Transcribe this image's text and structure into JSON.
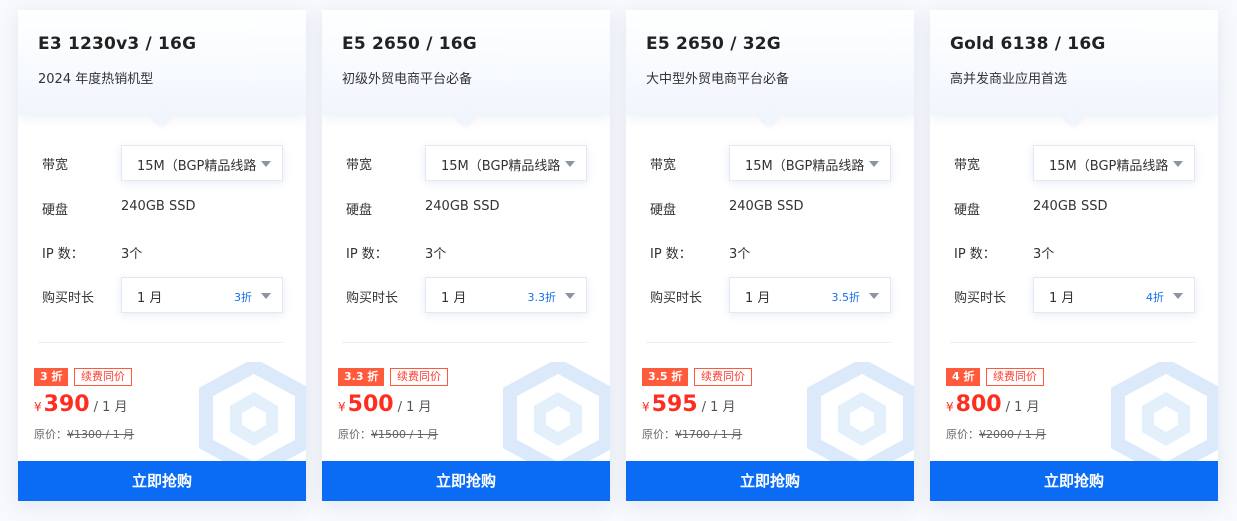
{
  "labels": {
    "bandwidth": "带宽",
    "disk": "硬盘",
    "ip": "IP 数：",
    "duration": "购买时长",
    "renew_tag": "续费同价",
    "orig_prefix": "原价：",
    "per_unit": "/ 1 月",
    "currency": "¥",
    "buy_button": "立即抢购"
  },
  "plans": [
    {
      "title": "E3 1230v3 / 16G",
      "subtitle": "2024 年度热销机型",
      "bandwidth": "15M（BGP精品线路）",
      "disk": "240GB SSD",
      "ip": "3个",
      "duration": "1 月",
      "duration_discount": "3折",
      "discount_tag": "3 折",
      "price": "390",
      "orig_price": "¥1300 / 1 月"
    },
    {
      "title": "E5 2650 / 16G",
      "subtitle": "初级外贸电商平台必备",
      "bandwidth": "15M（BGP精品线路）",
      "disk": "240GB SSD",
      "ip": "3个",
      "duration": "1 月",
      "duration_discount": "3.3折",
      "discount_tag": "3.3 折",
      "price": "500",
      "orig_price": "¥1500 / 1 月"
    },
    {
      "title": "E5 2650 / 32G",
      "subtitle": "大中型外贸电商平台必备",
      "bandwidth": "15M（BGP精品线路）",
      "disk": "240GB SSD",
      "ip": "3个",
      "duration": "1 月",
      "duration_discount": "3.5折",
      "discount_tag": "3.5 折",
      "price": "595",
      "orig_price": "¥1700 / 1 月"
    },
    {
      "title": "Gold 6138 / 16G",
      "subtitle": "高并发商业应用首选",
      "bandwidth": "15M（BGP精品线路）",
      "disk": "240GB SSD",
      "ip": "3个",
      "duration": "1 月",
      "duration_discount": "4折",
      "discount_tag": "4 折",
      "price": "800",
      "orig_price": "¥2000 / 1 月"
    }
  ],
  "colors": {
    "accent": "#0a6cf5",
    "price": "#ff2d1f",
    "discount_tag": "#ff5a3c",
    "duration_discount": "#1a6ee8"
  },
  "icons": {
    "select_caret": "caret-down-icon",
    "card_decoration": "hexagon-icon"
  }
}
